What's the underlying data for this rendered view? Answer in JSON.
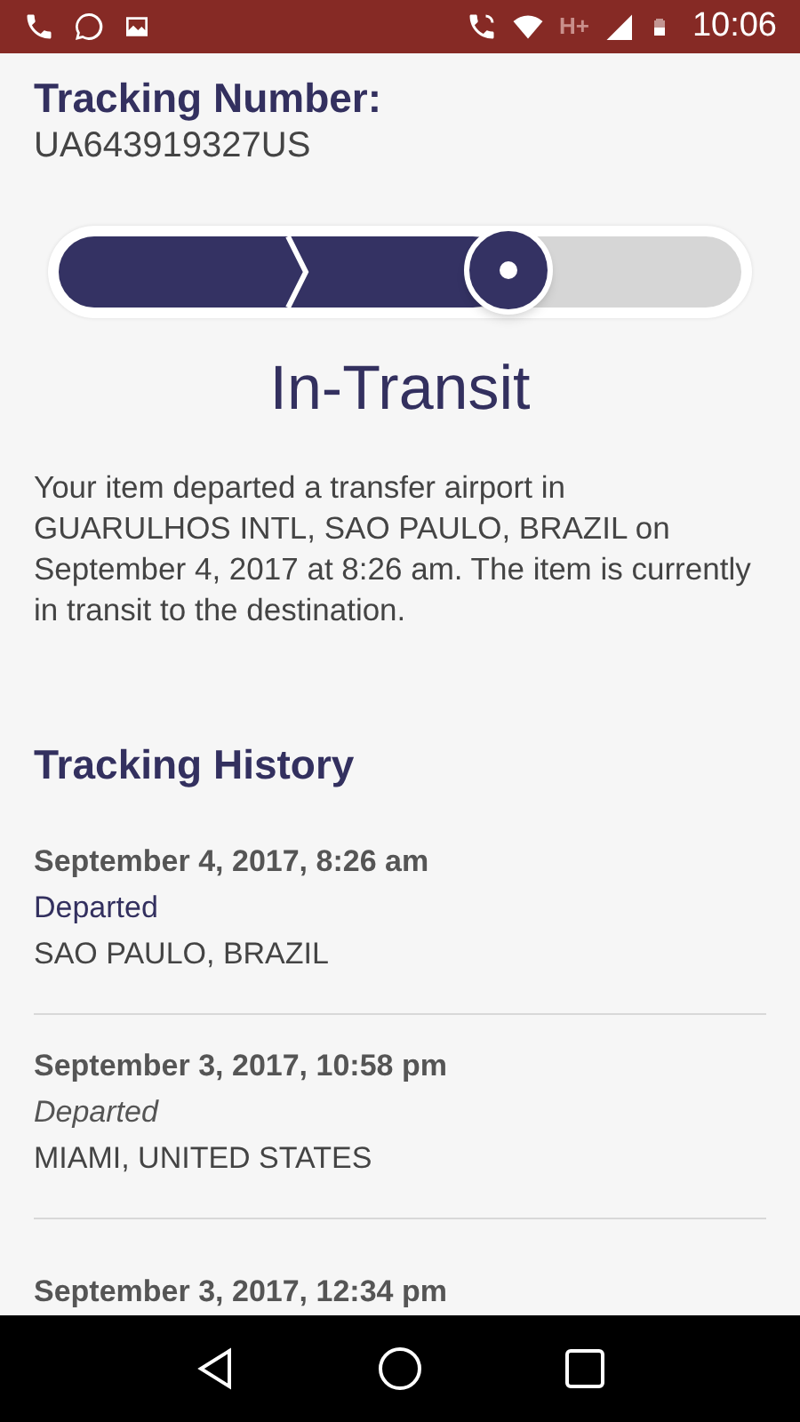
{
  "status_bar": {
    "network_label": "H+",
    "time": "10:06"
  },
  "tracking": {
    "label": "Tracking Number:",
    "number": "UA643919327US"
  },
  "progress": {
    "level": 0.66
  },
  "status": {
    "title": "In-Transit",
    "description": "Your item departed a transfer airport in GUARULHOS INTL, SAO PAULO, BRAZIL on September 4, 2017 at 8:26 am. The item is currently in transit to the destination."
  },
  "history": {
    "title": "Tracking History",
    "events": [
      {
        "datetime": "September 4, 2017, 8:26 am",
        "event": "Departed",
        "location": "SAO PAULO, BRAZIL",
        "latest": true
      },
      {
        "datetime": "September 3, 2017, 10:58 pm",
        "event": "Departed",
        "location": "MIAMI, UNITED STATES",
        "latest": false
      },
      {
        "datetime": "September 3, 2017, 12:34 pm"
      }
    ]
  }
}
